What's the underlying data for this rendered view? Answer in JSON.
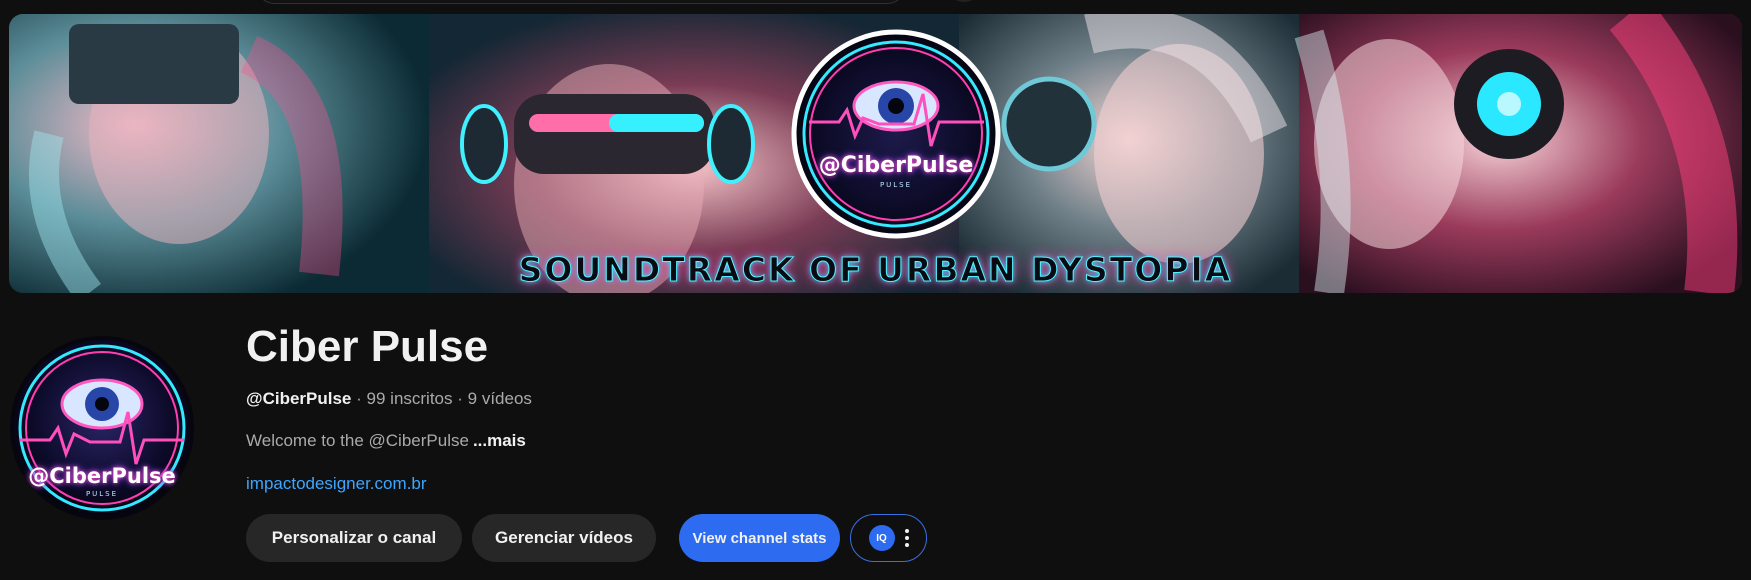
{
  "banner": {
    "title": "SOUNDTRACK OF URBAN DYSTOPIA",
    "badge_text": "@CiberPulse",
    "badge_sub": "PULSE"
  },
  "avatar": {
    "text": "@CiberPulse",
    "sub": "PULSE"
  },
  "channel": {
    "name": "Ciber Pulse",
    "handle": "@CiberPulse",
    "subscribers": "99 inscritos",
    "videos": "9 vídeos",
    "separator": "·",
    "description": "Welcome to the @CiberPulse",
    "more_label": "...mais",
    "link": "impactodesigner.com.br"
  },
  "actions": {
    "customize": "Personalizar o canal",
    "manage": "Gerenciar vídeos",
    "stats": "View channel stats",
    "iq_label": "IQ"
  },
  "colors": {
    "background": "#0f0f0f",
    "link": "#3ea6ff",
    "primary_button": "#2d6cf0",
    "neon_cyan": "#22e6ff",
    "neon_pink": "#ff2fa0"
  }
}
